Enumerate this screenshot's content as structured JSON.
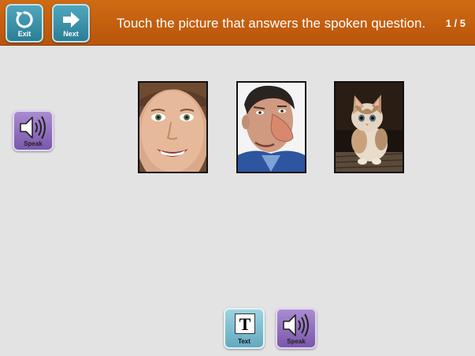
{
  "header": {
    "exit_label": "Exit",
    "next_label": "Next",
    "instruction": "Touch the picture that answers the spoken question.",
    "progress": "1 / 5",
    "colors": {
      "bar": "#c4600f",
      "nav_button": "#3b93ab"
    }
  },
  "speak_left": {
    "label": "Speak",
    "icon": "speaker-icon"
  },
  "choices": [
    {
      "subject": "smiling child face photo"
    },
    {
      "subject": "old man with large nose photo"
    },
    {
      "subject": "kitten sitting photo"
    }
  ],
  "bottom_bar": {
    "text_label": "Text",
    "text_glyph": "T",
    "speak_label": "Speak"
  }
}
